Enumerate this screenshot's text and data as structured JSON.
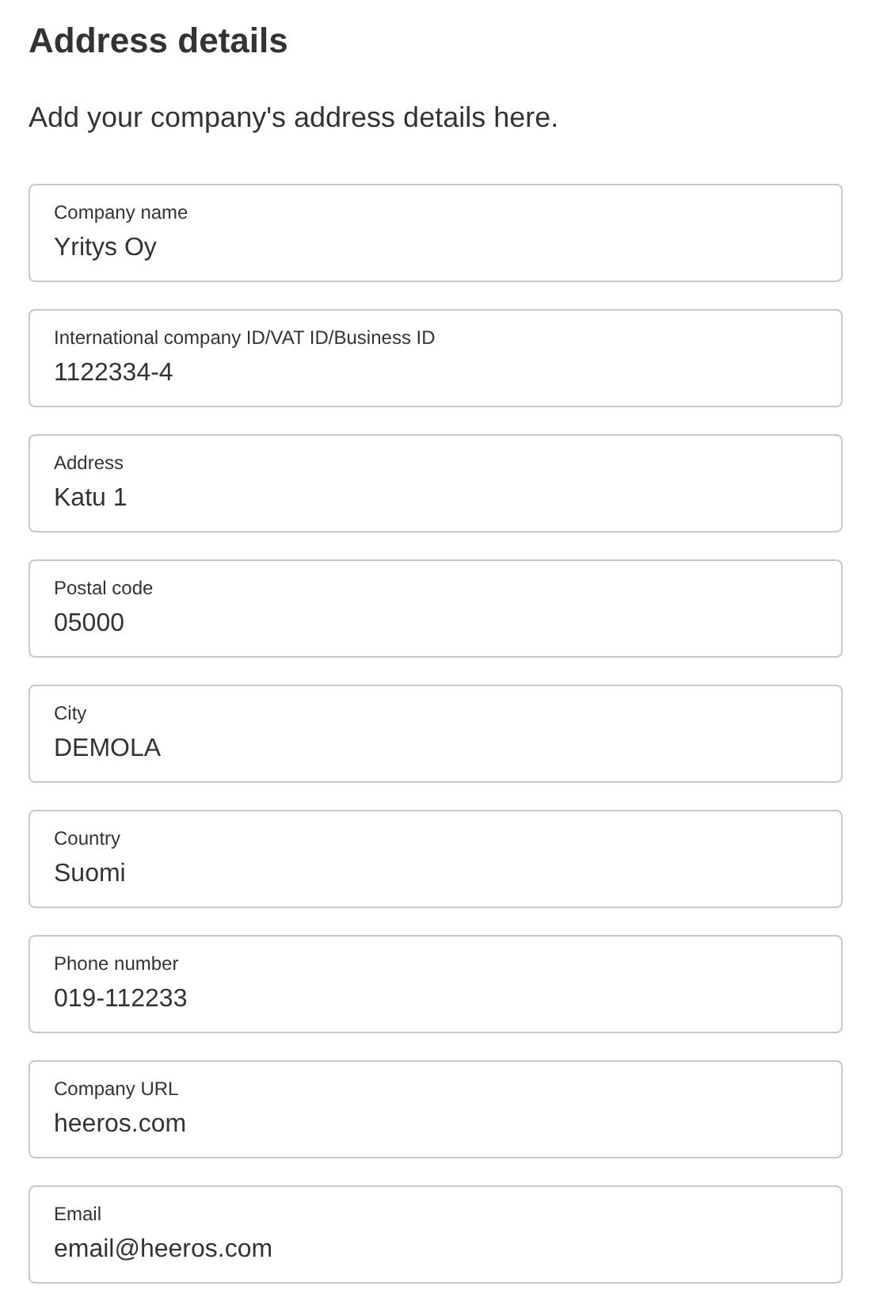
{
  "title": "Address details",
  "subtitle": "Add your company's address details here.",
  "fields": [
    {
      "label": "Company name",
      "value": "Yritys Oy"
    },
    {
      "label": "International company ID/VAT ID/Business ID",
      "value": "1122334-4"
    },
    {
      "label": "Address",
      "value": "Katu 1"
    },
    {
      "label": "Postal code",
      "value": "05000"
    },
    {
      "label": "City",
      "value": "DEMOLA"
    },
    {
      "label": "Country",
      "value": "Suomi"
    },
    {
      "label": "Phone number",
      "value": "019-112233"
    },
    {
      "label": "Company URL",
      "value": "heeros.com"
    },
    {
      "label": "Email",
      "value": "email@heeros.com"
    }
  ]
}
